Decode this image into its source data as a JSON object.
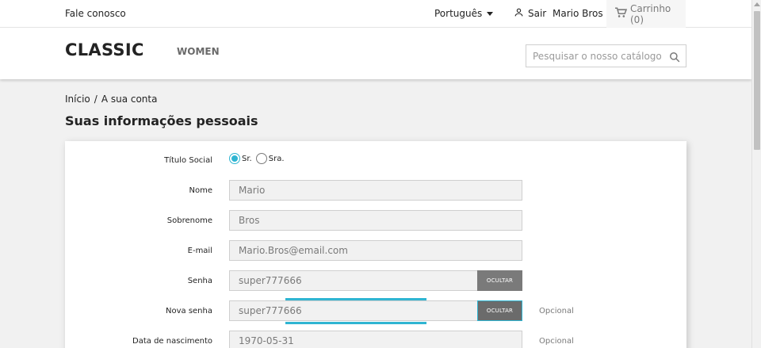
{
  "topbar": {
    "contact_label": "Fale conosco",
    "language": "Português",
    "signout_label": "Sair",
    "user_name": "Mario Bros",
    "cart_label": "Carrinho (0)"
  },
  "header": {
    "logo": "CLASSIC",
    "nav": [
      {
        "label": "WOMEN"
      }
    ],
    "search_placeholder": "Pesquisar o nosso catálogo"
  },
  "breadcrumb": {
    "items": [
      "Início",
      "A sua conta"
    ],
    "separator": "/"
  },
  "page_title": "Suas informações pessoais",
  "form": {
    "social_title": {
      "label": "Título Social",
      "options": [
        {
          "label": "Sr.",
          "selected": true
        },
        {
          "label": "Sra.",
          "selected": false
        }
      ]
    },
    "first_name": {
      "label": "Nome",
      "value": "Mario"
    },
    "last_name": {
      "label": "Sobrenome",
      "value": "Bros"
    },
    "email": {
      "label": "E-mail",
      "value": "Mario.Bros@email.com"
    },
    "password": {
      "label": "Senha",
      "value": "super777666",
      "toggle_label": "OCULTAR"
    },
    "new_password": {
      "label": "Nova senha",
      "value": "super777666",
      "toggle_label": "OCULTAR",
      "hint": "Opcional"
    },
    "birthdate": {
      "label": "Data de nascimento",
      "value": "1970-05-31",
      "hint": "Opcional"
    }
  },
  "colors": {
    "accent": "#2fb5d2",
    "button_gray": "#7a7a7a"
  }
}
